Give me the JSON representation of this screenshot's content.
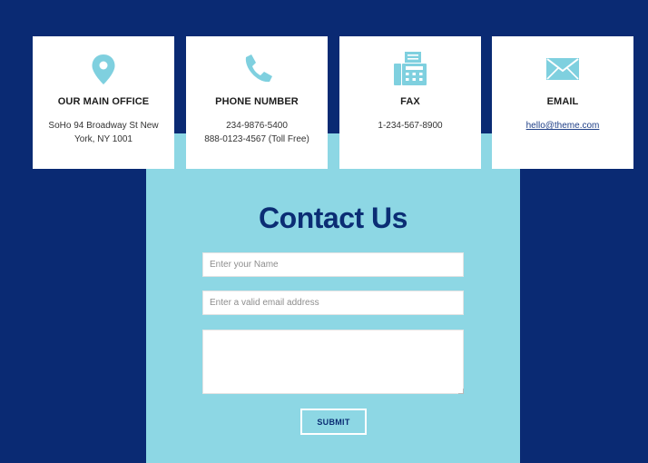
{
  "colors": {
    "background": "#0a2a73",
    "panel": "#8dd7e4",
    "card": "#ffffff",
    "icon": "#7fd0df",
    "title": "#0b2d74"
  },
  "cards": [
    {
      "icon": "map-pin-icon",
      "title": "OUR MAIN OFFICE",
      "lines": [
        "SoHo 94 Broadway St New",
        "York, NY 1001"
      ]
    },
    {
      "icon": "phone-icon",
      "title": "PHONE NUMBER",
      "lines": [
        "234-9876-5400",
        "888-0123-4567 (Toll Free)"
      ]
    },
    {
      "icon": "fax-icon",
      "title": "FAX",
      "lines": [
        "1-234-567-8900"
      ]
    },
    {
      "icon": "envelope-icon",
      "title": "EMAIL",
      "link": "hello@theme.com"
    }
  ],
  "form": {
    "title": "Contact Us",
    "name_placeholder": "Enter your Name",
    "email_placeholder": "Enter a valid email address",
    "message_placeholder": "",
    "submit_label": "SUBMIT"
  }
}
